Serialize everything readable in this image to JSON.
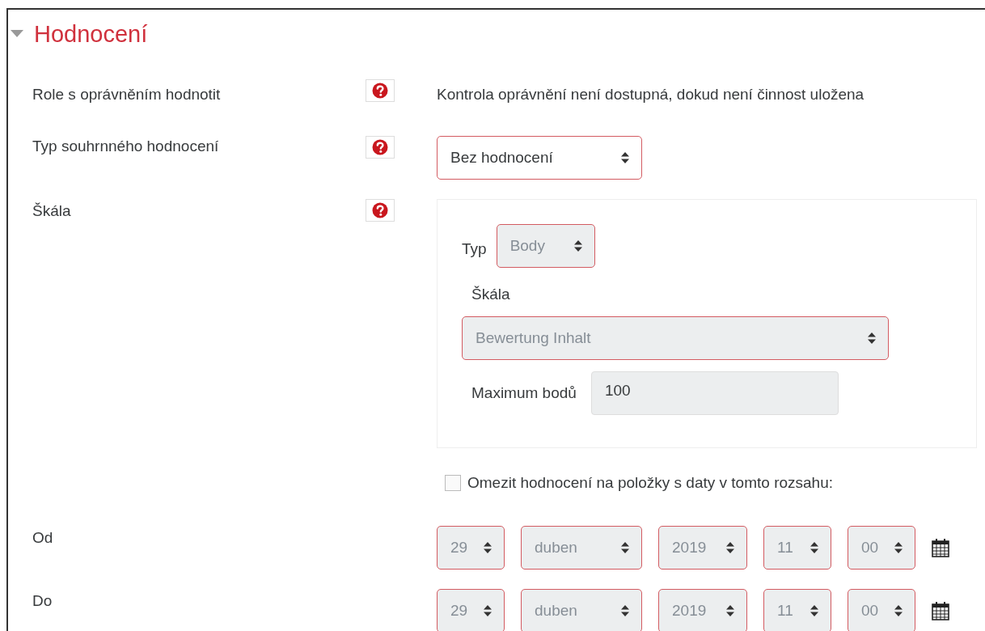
{
  "section": {
    "title": "Hodnocení",
    "expanded": true
  },
  "rows": [
    {
      "kind": "text",
      "label": "Role s oprávněním hodnotit",
      "help": true,
      "text": "Kontrola oprávnění není dostupná, dokud není činnost uložena"
    },
    {
      "kind": "select",
      "label": "Typ souhrnného hodnocení",
      "help": true,
      "select": {
        "value": "Bez hodnocení",
        "disabled": false
      }
    },
    {
      "kind": "grade",
      "label": "Škála",
      "help": true,
      "type_label": "Typ",
      "type_select": {
        "value": "Body",
        "disabled": true
      },
      "scale_label": "Škála",
      "scale_select": {
        "value": "Bewertung Inhalt",
        "disabled": true
      },
      "max_label": "Maximum bodů",
      "max_field": {
        "value": "100",
        "disabled": true
      }
    },
    {
      "kind": "checkbox",
      "checkbox": {
        "label": "Omezit hodnocení na položky s daty v tomto rozsahu:",
        "checked": false
      }
    },
    {
      "kind": "date",
      "label": "Od",
      "fields": [
        {
          "value": "29",
          "disabled": true
        },
        {
          "value": "duben",
          "disabled": true
        },
        {
          "value": "2019",
          "disabled": true
        },
        {
          "value": "11",
          "disabled": true
        },
        {
          "value": "00",
          "disabled": true
        }
      ]
    },
    {
      "kind": "date",
      "label": "Do",
      "fields": [
        {
          "value": "29",
          "disabled": true
        },
        {
          "value": "duben",
          "disabled": true
        },
        {
          "value": "2019",
          "disabled": true
        },
        {
          "value": "11",
          "disabled": true
        },
        {
          "value": "00",
          "disabled": true
        }
      ]
    }
  ]
}
